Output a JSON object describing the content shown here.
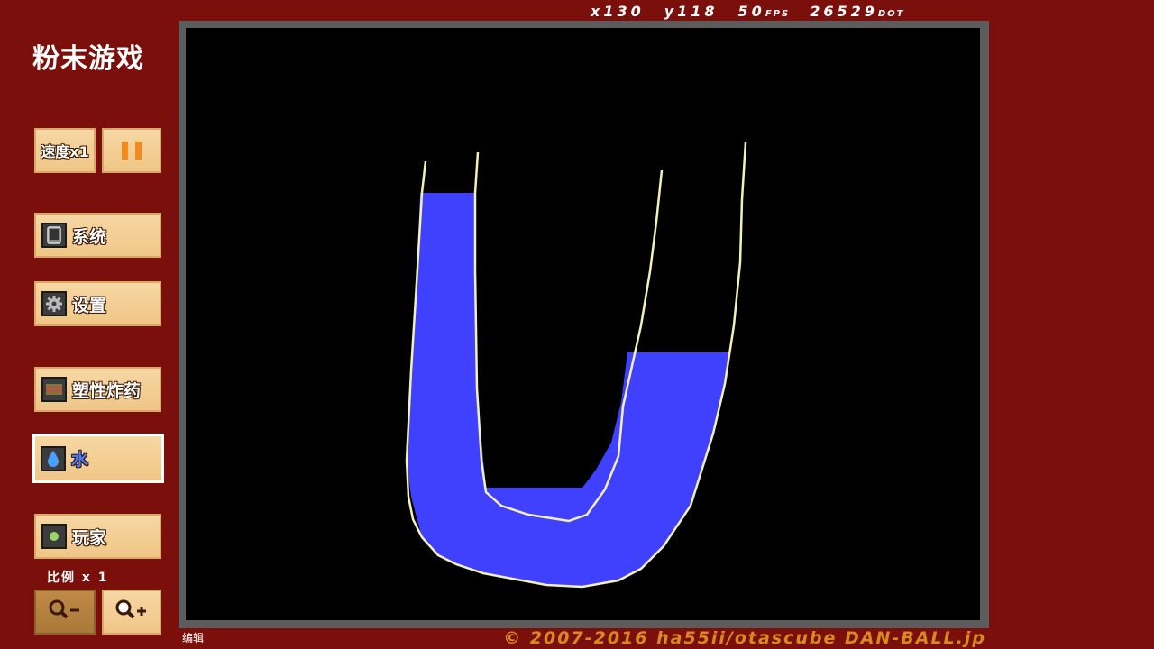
{
  "app_title": "粉末游戏",
  "stats": {
    "x": "x130",
    "y": "y118",
    "fps_value": "50",
    "fps_unit": "FPS",
    "dot_value": "26529",
    "dot_unit": "DOT"
  },
  "controls": {
    "speed_label": "速度x1",
    "pause_icon": "pause-icon"
  },
  "menu": {
    "system": {
      "label": "系统",
      "icon": "tablet-icon"
    },
    "settings": {
      "label": "设置",
      "icon": "gear-icon"
    },
    "plastic_explosive": {
      "label": "塑性炸药",
      "icon": "explosive-icon"
    },
    "water": {
      "label": "水",
      "icon": "water-drop-icon",
      "selected": true
    },
    "player": {
      "label": "玩家",
      "icon": "player-dot-icon"
    }
  },
  "scale": {
    "label": "比例 x 1"
  },
  "zoom": {
    "out_icon": "zoom-out-icon",
    "in_icon": "zoom-in-icon"
  },
  "footer": {
    "edit_label": "编辑",
    "copyright": "© 2007-2016 ha55ii/otascube DAN-BALL.jp"
  },
  "colors": {
    "background": "#7a0f0b",
    "button": "#f3cf97",
    "water": "#4040ff",
    "wall": "#f4f0b8",
    "copyright": "#d88a1f"
  }
}
